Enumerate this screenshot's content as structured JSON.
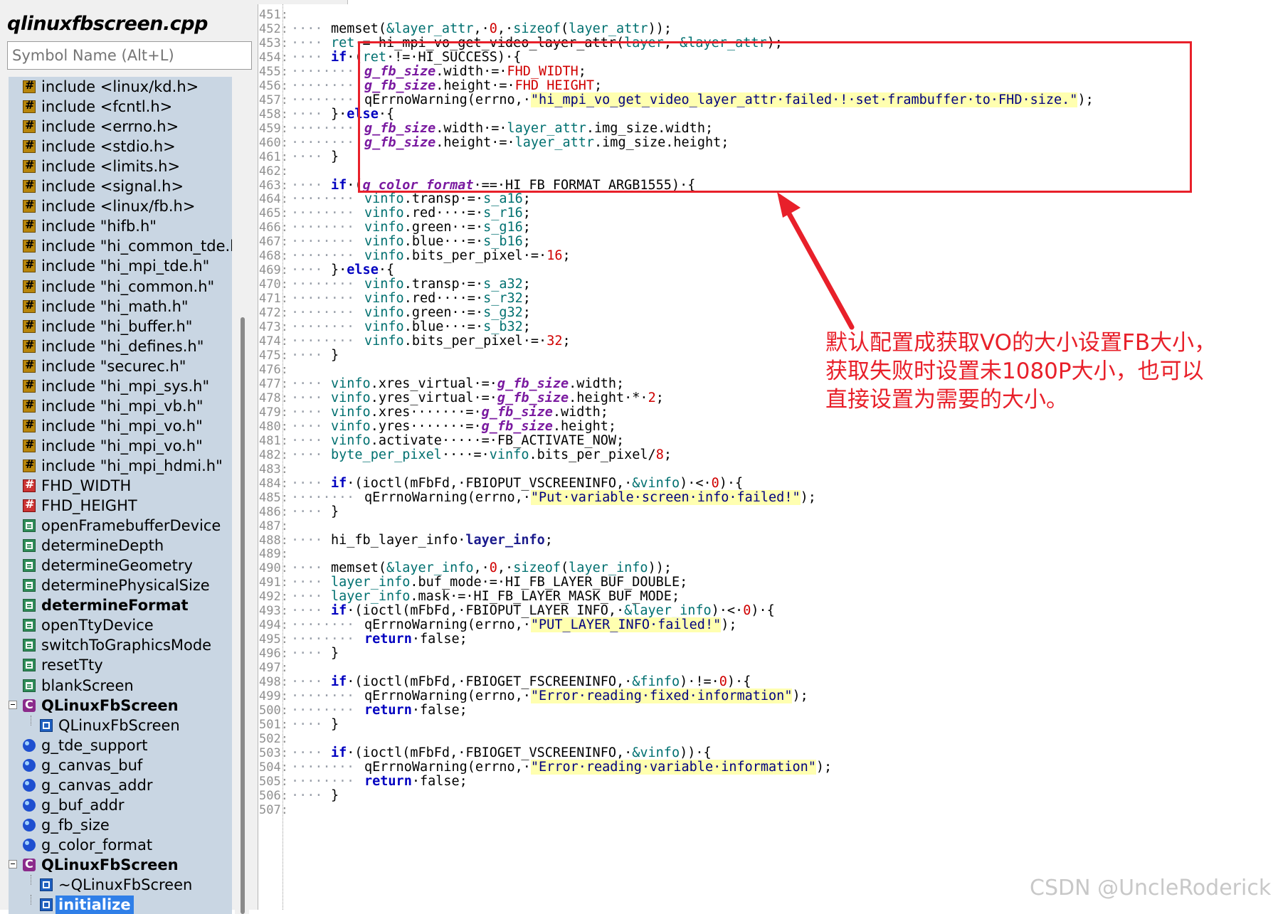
{
  "file_title": "qlinuxfbscreen.cpp",
  "symbol_search": {
    "placeholder": "Symbol Name (Alt+L)"
  },
  "symbols": [
    {
      "label": "include <linux/kd.h>",
      "icon": "include-icon"
    },
    {
      "label": "include <fcntl.h>",
      "icon": "include-icon"
    },
    {
      "label": "include <errno.h>",
      "icon": "include-icon"
    },
    {
      "label": "include <stdio.h>",
      "icon": "include-icon"
    },
    {
      "label": "include <limits.h>",
      "icon": "include-icon"
    },
    {
      "label": "include <signal.h>",
      "icon": "include-icon"
    },
    {
      "label": "include <linux/fb.h>",
      "icon": "include-icon"
    },
    {
      "label": "include \"hifb.h\"",
      "icon": "include-icon"
    },
    {
      "label": "include \"hi_common_tde.h",
      "icon": "include-icon"
    },
    {
      "label": "include \"hi_mpi_tde.h\"",
      "icon": "include-icon"
    },
    {
      "label": "include \"hi_common.h\"",
      "icon": "include-icon"
    },
    {
      "label": "include \"hi_math.h\"",
      "icon": "include-icon"
    },
    {
      "label": "include \"hi_buffer.h\"",
      "icon": "include-icon"
    },
    {
      "label": "include \"hi_defines.h\"",
      "icon": "include-icon"
    },
    {
      "label": "include \"securec.h\"",
      "icon": "include-icon"
    },
    {
      "label": "include \"hi_mpi_sys.h\"",
      "icon": "include-icon"
    },
    {
      "label": "include \"hi_mpi_vb.h\"",
      "icon": "include-icon"
    },
    {
      "label": "include \"hi_mpi_vo.h\"",
      "icon": "include-icon"
    },
    {
      "label": "include \"hi_mpi_vo.h\"",
      "icon": "include-icon"
    },
    {
      "label": "include \"hi_mpi_hdmi.h\"",
      "icon": "include-icon"
    },
    {
      "label": "FHD_WIDTH",
      "icon": "define-icon"
    },
    {
      "label": "FHD_HEIGHT",
      "icon": "define-icon"
    },
    {
      "label": "openFramebufferDevice",
      "icon": "function-icon"
    },
    {
      "label": "determineDepth",
      "icon": "function-icon"
    },
    {
      "label": "determineGeometry",
      "icon": "function-icon"
    },
    {
      "label": "determinePhysicalSize",
      "icon": "function-icon"
    },
    {
      "label": "determineFormat",
      "icon": "function-icon",
      "bold": true
    },
    {
      "label": "openTtyDevice",
      "icon": "function-icon"
    },
    {
      "label": "switchToGraphicsMode",
      "icon": "function-icon"
    },
    {
      "label": "resetTty",
      "icon": "function-icon"
    },
    {
      "label": "blankScreen",
      "icon": "function-icon"
    },
    {
      "label": "QLinuxFbScreen",
      "icon": "class-icon",
      "bold": true,
      "expander": true
    },
    {
      "label": "QLinuxFbScreen",
      "icon": "method-icon",
      "child": true
    },
    {
      "label": "g_tde_support",
      "icon": "variable-icon"
    },
    {
      "label": "g_canvas_buf",
      "icon": "variable-icon"
    },
    {
      "label": "g_canvas_addr",
      "icon": "variable-icon"
    },
    {
      "label": "g_buf_addr",
      "icon": "variable-icon"
    },
    {
      "label": "g_fb_size",
      "icon": "variable-icon"
    },
    {
      "label": "g_color_format",
      "icon": "variable-icon"
    },
    {
      "label": "QLinuxFbScreen",
      "icon": "class-icon",
      "bold": true,
      "expander": true
    },
    {
      "label": "~QLinuxFbScreen",
      "icon": "method-icon",
      "child": true
    },
    {
      "label": "initialize",
      "icon": "method-icon",
      "child": true,
      "selected": true
    }
  ],
  "code_lines": [
    {
      "n": "451:",
      "d": "",
      "html": ""
    },
    {
      "n": "452:",
      "d": "····",
      "html": "<span class='m'>memset</span>(<span class='v'>&amp;layer_attr</span>,·<span class='n'>0</span>,·<span class='v'>sizeof</span>(<span class='v'>layer_attr</span>));"
    },
    {
      "n": "453:",
      "d": "····",
      "html": "<span class='v'>ret</span>·=·hi_mpi_vo_get_video_layer_attr(<span class='v'>layer</span>,·<span class='v'>&amp;layer_attr</span>);"
    },
    {
      "n": "454:",
      "d": "····",
      "html": "<span class='k'>if</span>·(<span class='v'>ret</span>·!=·HI_SUCCESS)·{"
    },
    {
      "n": "455:",
      "d": "········",
      "html": "<span class='g'>g_fb_size</span>.width·=·<span class='r'>FHD_WIDTH</span>;"
    },
    {
      "n": "456:",
      "d": "········",
      "html": "<span class='g'>g_fb_size</span>.height·=·<span class='r'>FHD_HEIGHT</span>;"
    },
    {
      "n": "457:",
      "d": "········",
      "html": "qErrnoWarning(errno,·<span class='s'>\"hi_mpi_vo_get_video_layer_attr·failed·!·set·frambuffer·to·FHD·size.\"</span>);"
    },
    {
      "n": "458:",
      "d": "····",
      "html": "}·<span class='k'>else</span>·{"
    },
    {
      "n": "459:",
      "d": "········",
      "html": "<span class='g'>g_fb_size</span>.width·=·<span class='v'>layer_attr</span>.img_size.width;"
    },
    {
      "n": "460:",
      "d": "········",
      "html": "<span class='g'>g_fb_size</span>.height·=·<span class='v'>layer_attr</span>.img_size.height;"
    },
    {
      "n": "461:",
      "d": "····",
      "html": "}"
    },
    {
      "n": "462:",
      "d": "",
      "html": ""
    },
    {
      "n": "463:",
      "d": "····",
      "html": "<span class='k'>if</span>·(<span class='g'>g_color_format</span>·==·HI_FB_FORMAT_ARGB1555)·{"
    },
    {
      "n": "464:",
      "d": "········",
      "html": "<span class='v'>vinfo</span>.transp·=·<span class='v'>s_a16</span>;"
    },
    {
      "n": "465:",
      "d": "········",
      "html": "<span class='v'>vinfo</span>.red····=·<span class='v'>s_r16</span>;"
    },
    {
      "n": "466:",
      "d": "········",
      "html": "<span class='v'>vinfo</span>.green··=·<span class='v'>s_g16</span>;"
    },
    {
      "n": "467:",
      "d": "········",
      "html": "<span class='v'>vinfo</span>.blue···=·<span class='v'>s_b16</span>;"
    },
    {
      "n": "468:",
      "d": "········",
      "html": "<span class='v'>vinfo</span>.bits_per_pixel·=·<span class='n'>16</span>;"
    },
    {
      "n": "469:",
      "d": "····",
      "html": "}·<span class='k'>else</span>·{"
    },
    {
      "n": "470:",
      "d": "········",
      "html": "<span class='v'>vinfo</span>.transp·=·<span class='v'>s_a32</span>;"
    },
    {
      "n": "471:",
      "d": "········",
      "html": "<span class='v'>vinfo</span>.red····=·<span class='v'>s_r32</span>;"
    },
    {
      "n": "472:",
      "d": "········",
      "html": "<span class='v'>vinfo</span>.green··=·<span class='v'>s_g32</span>;"
    },
    {
      "n": "473:",
      "d": "········",
      "html": "<span class='v'>vinfo</span>.blue···=·<span class='v'>s_b32</span>;"
    },
    {
      "n": "474:",
      "d": "········",
      "html": "<span class='v'>vinfo</span>.bits_per_pixel·=·<span class='n'>32</span>;"
    },
    {
      "n": "475:",
      "d": "····",
      "html": "}"
    },
    {
      "n": "476:",
      "d": "",
      "html": ""
    },
    {
      "n": "477:",
      "d": "····",
      "html": "<span class='v'>vinfo</span>.xres_virtual·=·<span class='g'>g_fb_size</span>.width;"
    },
    {
      "n": "478:",
      "d": "····",
      "html": "<span class='v'>vinfo</span>.yres_virtual·=·<span class='g'>g_fb_size</span>.height·*·<span class='n'>2</span>;"
    },
    {
      "n": "479:",
      "d": "····",
      "html": "<span class='v'>vinfo</span>.xres·······=·<span class='g'>g_fb_size</span>.width;"
    },
    {
      "n": "480:",
      "d": "····",
      "html": "<span class='v'>vinfo</span>.yres·······=·<span class='g'>g_fb_size</span>.height;"
    },
    {
      "n": "481:",
      "d": "····",
      "html": "<span class='v'>vinfo</span>.activate·····=·FB_ACTIVATE_NOW;"
    },
    {
      "n": "482:",
      "d": "····",
      "html": "<span class='v'>byte_per_pixel</span>····=·<span class='v'>vinfo</span>.bits_per_pixel/<span class='n'>8</span>;"
    },
    {
      "n": "483:",
      "d": "",
      "html": ""
    },
    {
      "n": "484:",
      "d": "····",
      "html": "<span class='k'>if</span>·(ioctl(mFbFd,·FBIOPUT_VSCREENINFO,·<span class='v'>&amp;vinfo</span>)·&lt;·<span class='n'>0</span>)·{"
    },
    {
      "n": "485:",
      "d": "········",
      "html": "qErrnoWarning(errno,·<span class='s'>\"Put·variable·screen·info·failed!\"</span>);"
    },
    {
      "n": "486:",
      "d": "····",
      "html": "}"
    },
    {
      "n": "487:",
      "d": "",
      "html": ""
    },
    {
      "n": "488:",
      "d": "····",
      "html": "hi_fb_layer_info·<span class='b'>layer_info</span>;"
    },
    {
      "n": "489:",
      "d": "",
      "html": ""
    },
    {
      "n": "490:",
      "d": "····",
      "html": "memset(<span class='v'>&amp;layer_info</span>,·<span class='n'>0</span>,·<span class='v'>sizeof</span>(<span class='v'>layer_info</span>));"
    },
    {
      "n": "491:",
      "d": "····",
      "html": "<span class='v'>layer_info</span>.buf_mode·=·HI_FB_LAYER_BUF_DOUBLE;"
    },
    {
      "n": "492:",
      "d": "····",
      "html": "<span class='v'>layer_info</span>.mask·=·HI_FB_LAYER_MASK_BUF_MODE;"
    },
    {
      "n": "493:",
      "d": "····",
      "html": "<span class='k'>if</span>·(ioctl(mFbFd,·FBIOPUT_LAYER_INFO,·<span class='v'>&amp;layer_info</span>)·&lt;·<span class='n'>0</span>)·{"
    },
    {
      "n": "494:",
      "d": "········",
      "html": "qErrnoWarning(errno,·<span class='s'>\"PUT_LAYER_INFO·failed!\"</span>);"
    },
    {
      "n": "495:",
      "d": "········",
      "html": "<span class='k'>return</span>·false;"
    },
    {
      "n": "496:",
      "d": "····",
      "html": "}"
    },
    {
      "n": "497:",
      "d": "",
      "html": ""
    },
    {
      "n": "498:",
      "d": "····",
      "html": "<span class='k'>if</span>·(ioctl(mFbFd,·FBIOGET_FSCREENINFO,·<span class='v'>&amp;finfo</span>)·!=·<span class='n'>0</span>)·{"
    },
    {
      "n": "499:",
      "d": "········",
      "html": "qErrnoWarning(errno,·<span class='s'>\"Error·reading·fixed·information\"</span>);"
    },
    {
      "n": "500:",
      "d": "········",
      "html": "<span class='k'>return</span>·false;"
    },
    {
      "n": "501:",
      "d": "····",
      "html": "}"
    },
    {
      "n": "502:",
      "d": "",
      "html": ""
    },
    {
      "n": "503:",
      "d": "····",
      "html": "<span class='k'>if</span>·(ioctl(mFbFd,·FBIOGET_VSCREENINFO,·<span class='v'>&amp;vinfo</span>))·{"
    },
    {
      "n": "504:",
      "d": "········",
      "html": "qErrnoWarning(errno,·<span class='s'>\"Error·reading·variable·information\"</span>);"
    },
    {
      "n": "505:",
      "d": "········",
      "html": "<span class='k'>return</span>·false;"
    },
    {
      "n": "506:",
      "d": "····",
      "html": "}"
    },
    {
      "n": "507:",
      "d": "",
      "html": ""
    }
  ],
  "annotation": {
    "lines": [
      "默认配置成获取VO的大小设置FB大小，",
      "获取失败时设置未1080P大小，也可以",
      "直接设置为需要的大小。"
    ],
    "color": "#e8202a"
  },
  "watermark": "CSDN @UncleRoderick"
}
